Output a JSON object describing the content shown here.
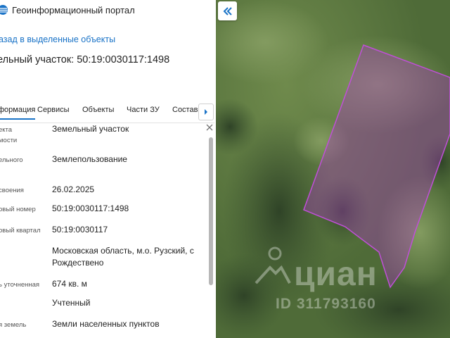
{
  "portal": {
    "title": "Геоинформационный портал"
  },
  "nav": {
    "back_label": "азад в выделенные объекты"
  },
  "plot": {
    "title": "ельный участок: 50:19:0030117:1498"
  },
  "tabs": [
    {
      "label": "формация",
      "active": true
    },
    {
      "label": "Сервисы",
      "active": false
    },
    {
      "label": "Объекты",
      "active": false
    },
    {
      "label": "Части ЗУ",
      "active": false
    },
    {
      "label": "Состав",
      "active": false
    }
  ],
  "info_rows": [
    {
      "label_lines": [
        "екта",
        "мости"
      ],
      "value": "Земельный участок"
    },
    {
      "label_lines": [
        "ельного"
      ],
      "value": "Землепользование"
    },
    {
      "label_lines": [
        "своения"
      ],
      "value": "26.02.2025"
    },
    {
      "label_lines": [
        "овый номер"
      ],
      "value": "50:19:0030117:1498"
    },
    {
      "label_lines": [
        "овый квартал"
      ],
      "value": "50:19:0030117"
    },
    {
      "label_lines": [
        ""
      ],
      "value": "Московская область, м.о. Рузский, с Рождествено"
    },
    {
      "label_lines": [
        "ь уточненная"
      ],
      "value": "674 кв. м"
    },
    {
      "label_lines": [
        ""
      ],
      "value": "Учтенный"
    },
    {
      "label_lines": [
        "я земель"
      ],
      "value": "Земли населенных пунктов"
    }
  ],
  "map": {
    "parcel_color": "#a43fb8",
    "watermark_brand": "циан",
    "watermark_id": "ID 311793160"
  },
  "icons": {
    "portal_logo": "globe-icon",
    "tab_scroll": "chevron-right-icon",
    "close": "close-icon",
    "collapse": "double-chevron-left-icon"
  }
}
